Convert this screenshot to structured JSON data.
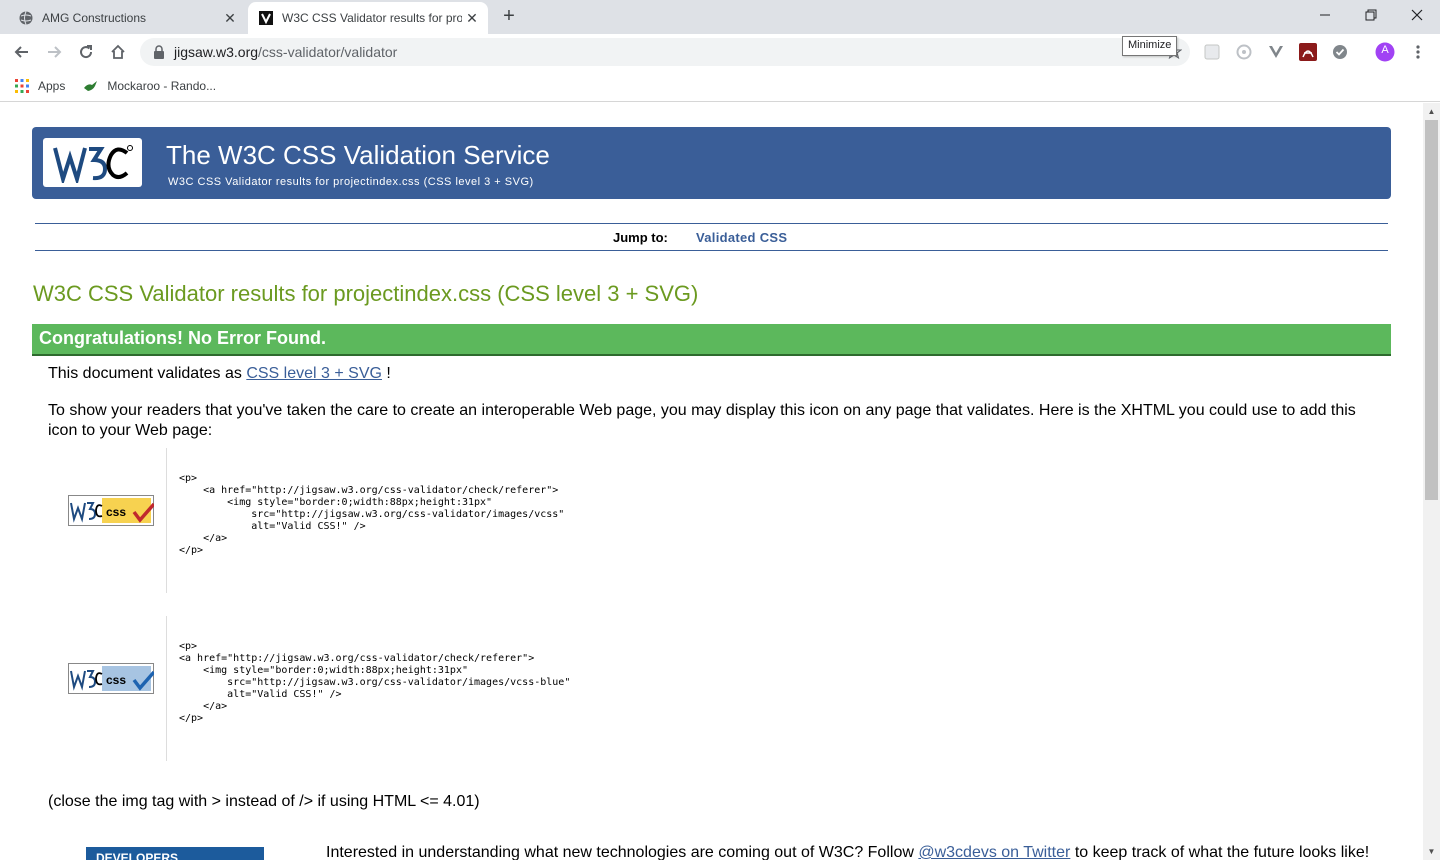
{
  "browser": {
    "tabs": [
      {
        "title": "AMG Constructions",
        "active": false
      },
      {
        "title": "W3C CSS Validator results for pro",
        "active": true
      }
    ],
    "url_host": "jigsaw.w3.org",
    "url_path": "/css-validator/validator",
    "tooltip": "Minimize",
    "bookmarks": [
      "Apps",
      "Mockaroo - Rando..."
    ],
    "profile_initial": "A"
  },
  "page": {
    "banner_title": "The W3C CSS Validation Service",
    "banner_subtitle": "W3C CSS Validator results for projectindex.css (CSS level 3 + SVG)",
    "jump_label": "Jump to:",
    "jump_link": "Validated CSS",
    "results_title": "W3C CSS Validator results for projectindex.css (CSS level 3 + SVG)",
    "congrats": "Congratulations! No Error Found.",
    "validates_prefix": "This document validates as",
    "validates_link": "CSS level 3 + SVG",
    "validates_suffix": "!",
    "readers_text": "To show your readers that you've taken the care to create an interoperable Web page, you may display this icon on any page that validates. Here is the XHTML you could use to add this icon to your Web page:",
    "code1": "<p>\n    <a href=\"http://jigsaw.w3.org/css-validator/check/referer\">\n        <img style=\"border:0;width:88px;height:31px\"\n            src=\"http://jigsaw.w3.org/css-validator/images/vcss\"\n            alt=\"Valid CSS!\" />\n    </a>\n</p>",
    "code2": "<p>\n<a href=\"http://jigsaw.w3.org/css-validator/check/referer\">\n    <img style=\"border:0;width:88px;height:31px\"\n        src=\"http://jigsaw.w3.org/css-validator/images/vcss-blue\"\n        alt=\"Valid CSS!\" />\n    </a>\n</p>",
    "close_note": "(close the img tag with > instead of /> if using HTML <= 4.01)",
    "interested_prefix": "Interested in understanding what new technologies are coming out of W3C? Follow",
    "interested_link": "@w3cdevs on Twitter",
    "interested_suffix": "to keep track of what the future looks like!",
    "dev_banner": "DEVELOPERS",
    "badge_text": "css"
  },
  "colors": {
    "banner": "#3a5e98",
    "congrats": "#5cb85c",
    "results_title": "#6b9a20"
  }
}
